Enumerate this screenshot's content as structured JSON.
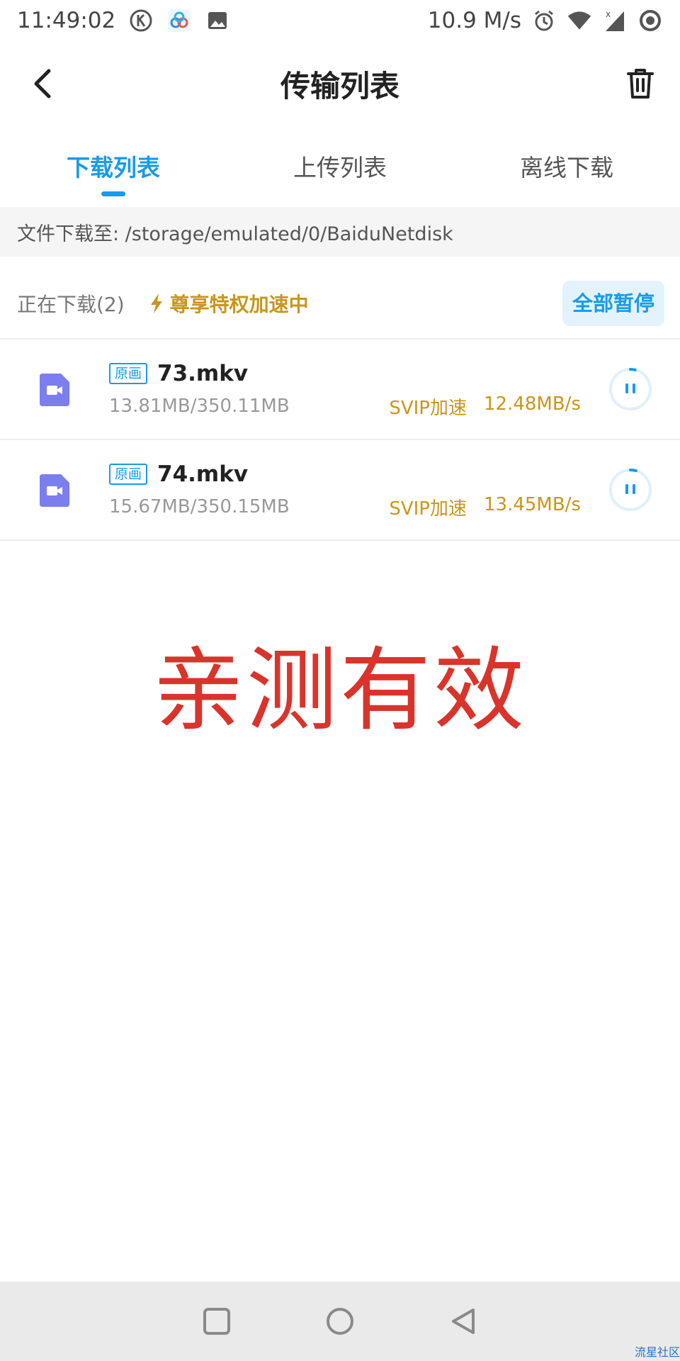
{
  "status_bar": {
    "time": "11:49:02",
    "network_speed": "10.9 M/s",
    "left_icons": [
      "k-app-icon",
      "baidu-netdisk-icon",
      "image-icon"
    ],
    "right_icons": [
      "alarm-icon",
      "wifi-icon",
      "signal-icon",
      "record-icon"
    ]
  },
  "header": {
    "title": "传输列表",
    "back_icon": "chevron-left-icon",
    "delete_icon": "trash-icon"
  },
  "tabs": [
    {
      "label": "下载列表",
      "active": true
    },
    {
      "label": "上传列表",
      "active": false
    },
    {
      "label": "离线下载",
      "active": false
    }
  ],
  "path_bar": {
    "text": "文件下载至: /storage/emulated/0/BaiduNetdisk"
  },
  "section": {
    "downloading_label": "正在下载(2)",
    "privilege_label": "尊享特权加速中",
    "pause_all_label": "全部暂停"
  },
  "downloads": [
    {
      "tag": "原画",
      "name": "73.mkv",
      "size": "13.81MB/350.11MB",
      "accel_label": "SVIP加速",
      "speed": "12.48MB/s",
      "progress": 0.039
    },
    {
      "tag": "原画",
      "name": "74.mkv",
      "size": "15.67MB/350.15MB",
      "accel_label": "SVIP加速",
      "speed": "13.45MB/s",
      "progress": 0.045
    }
  ],
  "overlay_caption": "亲测有效",
  "watermark": "流星社区",
  "colors": {
    "accent": "#1a9be8",
    "gold": "#c8961a",
    "caption_red": "#d9342b",
    "file_icon": "#7c7ef0"
  }
}
